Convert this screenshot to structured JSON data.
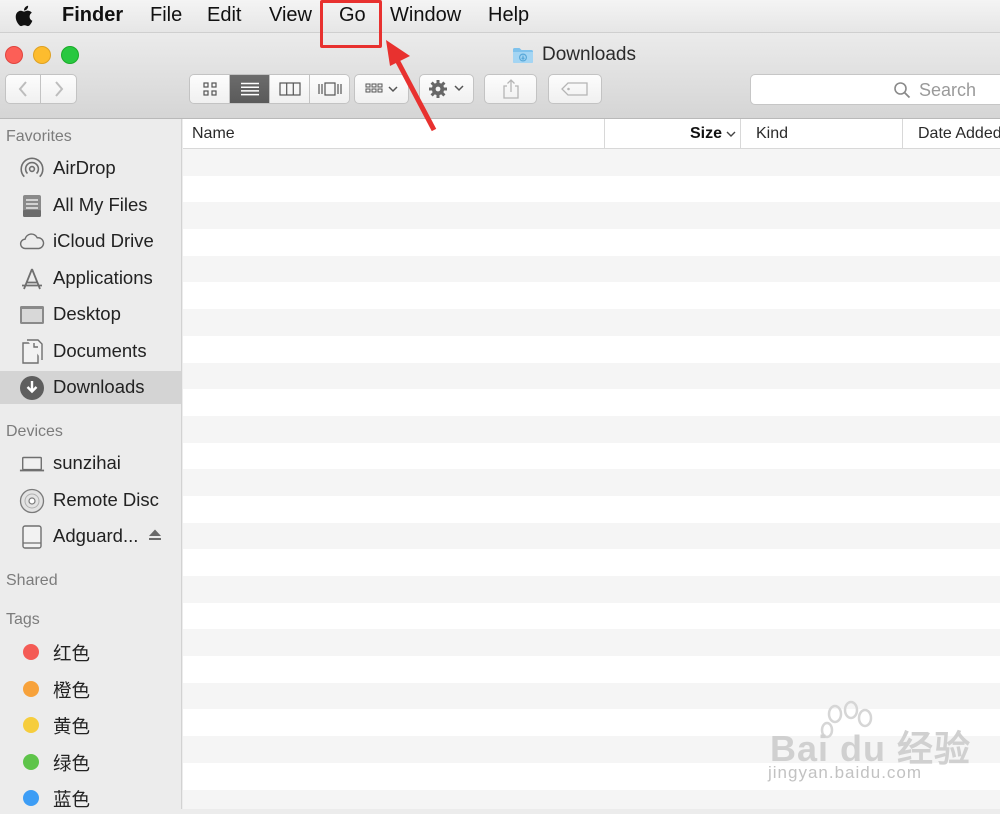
{
  "menubar": {
    "apple_icon": "apple-logo-icon",
    "items": [
      {
        "label": "Finder"
      },
      {
        "label": "File"
      },
      {
        "label": "Edit"
      },
      {
        "label": "View"
      },
      {
        "label": "Go"
      },
      {
        "label": "Window"
      },
      {
        "label": "Help"
      }
    ]
  },
  "annotation": {
    "color": "#e8312f",
    "target": "Go"
  },
  "window": {
    "title": "Downloads",
    "title_icon": "downloads-folder-icon"
  },
  "toolbar": {
    "nav": [
      "chevron-left-icon",
      "chevron-right-icon"
    ],
    "view_modes": [
      "icon-view-icon",
      "list-view-icon",
      "column-view-icon",
      "cover-flow-icon"
    ],
    "active_view": "list",
    "arrange_icon": "arrange-grid-icon",
    "action_icon": "gear-icon",
    "share_icon": "share-icon",
    "tags_icon": "tag-icon",
    "search": {
      "placeholder": "Search",
      "value": ""
    }
  },
  "sidebar": {
    "favorites_heading": "Favorites",
    "favorites": [
      {
        "label": "AirDrop",
        "icon": "airdrop-icon"
      },
      {
        "label": "All My Files",
        "icon": "all-files-icon"
      },
      {
        "label": "iCloud Drive",
        "icon": "cloud-icon"
      },
      {
        "label": "Applications",
        "icon": "applications-icon"
      },
      {
        "label": "Desktop",
        "icon": "desktop-icon"
      },
      {
        "label": "Documents",
        "icon": "documents-icon"
      },
      {
        "label": "Downloads",
        "icon": "download-icon",
        "selected": true
      }
    ],
    "devices_heading": "Devices",
    "devices": [
      {
        "label": "sunzihai",
        "icon": "laptop-icon"
      },
      {
        "label": "Remote Disc",
        "icon": "disc-icon"
      },
      {
        "label": "Adguard...",
        "icon": "drive-icon",
        "eject": true
      }
    ],
    "shared_heading": "Shared",
    "tags_heading": "Tags",
    "tags": [
      {
        "label": "红色",
        "color": "#f45b55"
      },
      {
        "label": "橙色",
        "color": "#f7a23b"
      },
      {
        "label": "黄色",
        "color": "#f6cd3d"
      },
      {
        "label": "绿色",
        "color": "#5ec44a"
      },
      {
        "label": "蓝色",
        "color": "#3d9df5"
      }
    ]
  },
  "list": {
    "columns": [
      {
        "label": "Name"
      },
      {
        "label": "Size",
        "sorted": "descending"
      },
      {
        "label": "Kind"
      },
      {
        "label": "Date Added"
      }
    ],
    "rows": []
  },
  "watermark": {
    "main": "Bai du 经验",
    "sub": "jingyan.baidu.com"
  }
}
